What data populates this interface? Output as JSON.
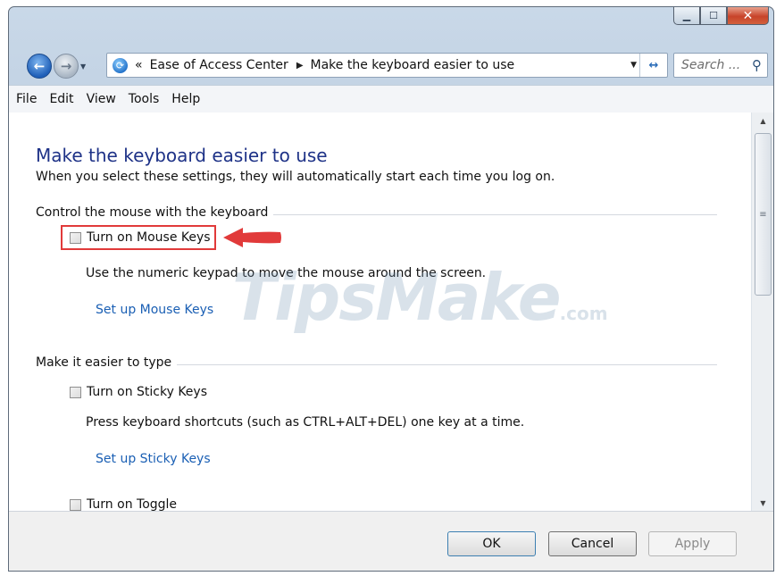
{
  "window": {
    "caption_buttons": {
      "minimize_icon": "minimize-icon",
      "maximize_icon": "maximize-icon",
      "close_icon": "close-icon"
    }
  },
  "nav": {
    "back_icon": "back-arrow-icon",
    "forward_icon": "forward-arrow-icon",
    "breadcrumb": [
      "Ease of Access Center",
      "Make the keyboard easier to use"
    ],
    "overflow": "«",
    "search_placeholder": "Search ..."
  },
  "menu": {
    "items": [
      "File",
      "Edit",
      "View",
      "Tools",
      "Help"
    ]
  },
  "page": {
    "title": "Make the keyboard easier to use",
    "subtitle": "When you select these settings, they will automatically start each time you log on."
  },
  "sections": [
    {
      "heading": "Control the mouse with the keyboard",
      "checkbox": {
        "label": "Turn on Mouse Keys",
        "checked": false
      },
      "description": "Use the numeric keypad to move the mouse around the screen.",
      "link": "Set up Mouse Keys"
    },
    {
      "heading": "Make it easier to type",
      "checkbox": {
        "label": "Turn on Sticky Keys",
        "checked": false
      },
      "description": "Press keyboard shortcuts (such as CTRL+ALT+DEL) one key at a time.",
      "link": "Set up Sticky Keys"
    }
  ],
  "partial_item": {
    "label": "Turn on Toggle",
    "checked": false
  },
  "annotation": {
    "highlight_color": "#e13a3a"
  },
  "watermark": {
    "main": "TipsMake",
    "suffix": ".com"
  },
  "buttons": {
    "ok": "OK",
    "cancel": "Cancel",
    "apply": "Apply"
  }
}
